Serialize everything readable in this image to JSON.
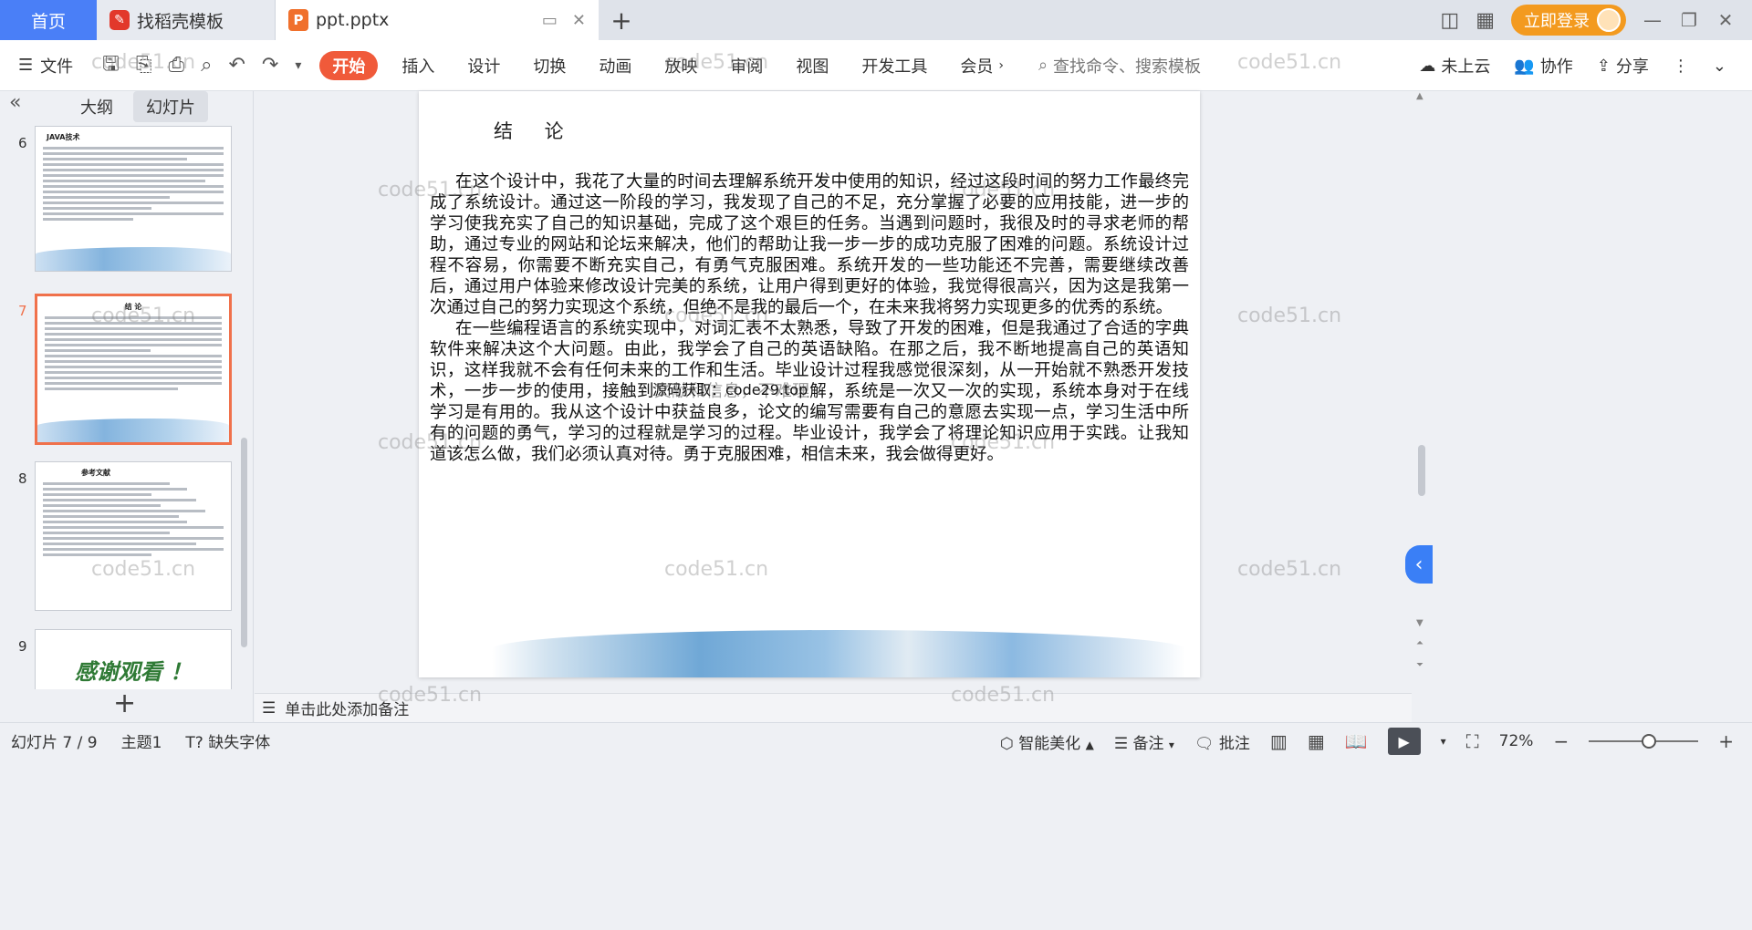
{
  "tabs": {
    "home": "首页",
    "find_template": "找稻壳模板",
    "doc": "ppt.pptx",
    "login": "立即登录"
  },
  "ribbon": {
    "file": "文件",
    "tabs": [
      "开始",
      "插入",
      "设计",
      "切换",
      "动画",
      "放映",
      "审阅",
      "视图",
      "开发工具",
      "会员"
    ],
    "search_placeholder": "查找命令、搜索模板",
    "cloud": "未上云",
    "collab": "协作",
    "share": "分享"
  },
  "left_panel": {
    "view_tabs": [
      "大纲",
      "幻灯片"
    ],
    "thumbnails": [
      {
        "num": "6",
        "title": "JAVA技术"
      },
      {
        "num": "7",
        "title": "结 论"
      },
      {
        "num": "8",
        "title": "参考文献"
      },
      {
        "num": "9",
        "title": "感谢观看 ！"
      }
    ]
  },
  "slide": {
    "title": "结 论",
    "paragraph1": "在这个设计中，我花了大量的时间去理解系统开发中使用的知识，经过这段时间的努力工作最终完成了系统设计。通过这一阶段的学习，我发现了自己的不足，充分掌握了必要的应用技能，进一步的学习使我充实了自己的知识基础，完成了这个艰巨的任务。当遇到问题时，我很及时的寻求老师的帮助，通过专业的网站和论坛来解决，他们的帮助让我一步一步的成功克服了困难的问题。系统设计过程不容易，你需要不断充实自己，有勇气克服困难。系统开发的一些功能还不完善，需要继续改善后，通过用户体验来修改设计完美的系统，让用户得到更好的体验，我觉得很高兴，因为这是我第一次通过自己的努力实现这个系统，但绝不是我的最后一个，在未来我将努力实现更多的优秀的系统。",
    "paragraph2": "在一些编程语言的系统实现中，对词汇表不太熟悉，导致了开发的困难，但是我通过了合适的字典软件来解决这个大问题。由此，我学会了自己的英语缺陷。在那之后，我不断地提高自己的英语知识，这样我就不会有任何未来的工作和生活。毕业设计过程我感觉很深刻，从一开始就不熟悉开发技术，一步一步的使用，接触到文献和信息，不难理解，系统是一次又一次的实现，系统本身对于在线学习是有用的。我从这个设计中获益良多，论文的编写需要有自己的意愿去实现一点，学习生活中所有的问题的勇气，学习的过程就是学习的过程。毕业设计，我学会了将理论知识应用于实践。让我知道该怎么做，我们必须认真对待。勇于克服困难，相信未来，我会做得更好。",
    "overlay": "源码获取：code29.top"
  },
  "notes_placeholder": "单击此处添加备注",
  "status": {
    "slide_counter": "幻灯片 7 / 9",
    "theme": "主题1",
    "missing_font": "缺失字体",
    "smart_beautify": "智能美化",
    "notes": "备注",
    "comment": "批注",
    "zoom": "72%"
  },
  "watermark": "code51.cn",
  "colors": {
    "home_tab": "#4a7ff7",
    "active_ribbon_tab": "#f05a3a",
    "login_button": "#f39a1f",
    "active_thumb_border": "#f0714b"
  }
}
